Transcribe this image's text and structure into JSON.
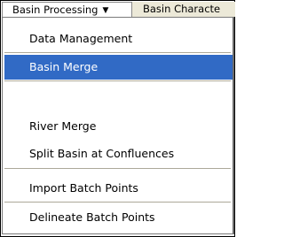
{
  "menubar": {
    "items": [
      {
        "label": "Basin Processing",
        "state": "open"
      },
      {
        "label": "Basin Characte"
      }
    ]
  },
  "menu": {
    "items": [
      {
        "label": "Data Management"
      },
      {
        "label": "Basin Merge",
        "highlighted": true
      },
      {
        "label": "River Merge"
      },
      {
        "label": "Split Basin at Confluences"
      },
      {
        "label": "Import Batch Points"
      },
      {
        "label": "Delineate Batch Points"
      }
    ]
  },
  "colors": {
    "highlight": "#316ac5",
    "menubar_bg": "#ece9d8"
  },
  "icons": {
    "dropdown": "caret-down-icon"
  }
}
